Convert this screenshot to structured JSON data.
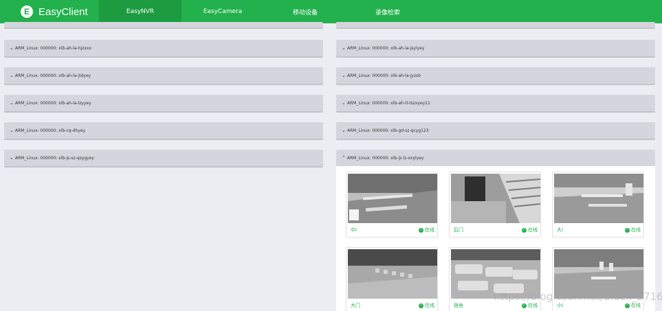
{
  "app": {
    "name": "EasyClient",
    "logo_letter": "E"
  },
  "nav": {
    "items": [
      {
        "label": "EasyNVR",
        "active": true
      },
      {
        "label": "EasyCamera",
        "active": false
      },
      {
        "label": "移动设备",
        "active": false
      },
      {
        "label": "录像检索",
        "active": false
      }
    ]
  },
  "devices": {
    "left": [
      "ARM_Linux: 000000: xlb-ah-la-hjzxxx",
      "ARM_Linux: 000000: xlb-ah-la-jtdyey",
      "ARM_Linux: 000000: xlb-ah-la-lzyyey",
      "ARM_Linux: 000000: xlb-cq-dhyey",
      "ARM_Linux: 000000: xlb-js-sz-qsygyey"
    ],
    "right": [
      "ARM_Linux: 000000: xlb-ah-la-jsylyey",
      "ARM_Linux: 000000: xlb-ah-la-jyzsb",
      "ARM_Linux: 000000: xlb-ah-tl-tszxyey11",
      "ARM_Linux: 000000: xlb-gd-sz-qcyg123"
    ],
    "expanded": "ARM_Linux: 000000: xlb-js-lz-xxylyey"
  },
  "cameras": [
    {
      "name": "中I",
      "status": "在线"
    },
    {
      "name": "后门",
      "status": "在线"
    },
    {
      "name": "大I",
      "status": "在线"
    },
    {
      "name": "大门",
      "status": "在线"
    },
    {
      "name": "宿舍",
      "status": "在线"
    },
    {
      "name": "小I",
      "status": "在线"
    }
  ],
  "watermark": "https://blog.csdn.net/Black_2716",
  "colors": {
    "accent": "#22b14c",
    "accent_dark": "#1c9b41",
    "background": "#ecedf2",
    "bar": "#d5d5dd"
  },
  "icons": {
    "brand": "easyclient-logo-icon",
    "collapsed": "chevron-down-icon",
    "expanded": "chevron-up-icon",
    "status": "check-circle-icon"
  }
}
